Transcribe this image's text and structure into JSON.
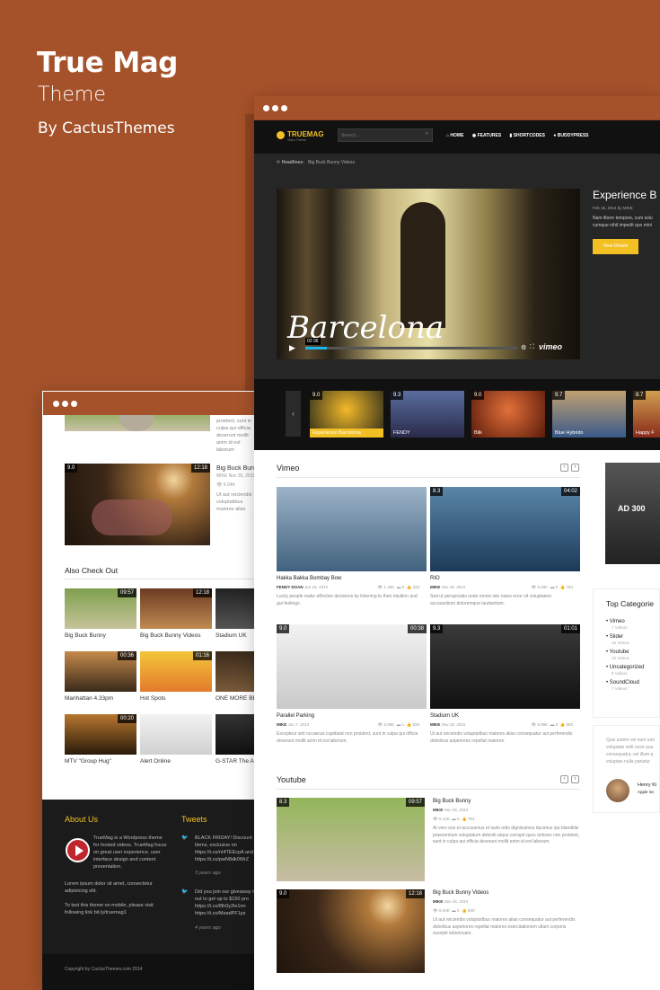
{
  "promo": {
    "title": "True Mag",
    "subtitle": "Theme",
    "byline": "By CactusThemes"
  },
  "colors": {
    "background": "#a5522a",
    "accent": "#f3c024",
    "dark": "#262626"
  },
  "back": {
    "top_items": [
      {
        "title": "Big Buck Bunny Videos",
        "score": "9.0",
        "duration": "12:18",
        "author": "MIKE",
        "date": "Nov 26, 2015",
        "views": "6.04K",
        "desc": "Ut aut reiciendis voluptatibus maiores alias consequatur aut perferendis doloribus asperiores repellat maiores exercitationem"
      }
    ],
    "top_partial": {
      "title": "Big Buck Bunny",
      "desc": "proident, sunt in culpa qui officia deserunt mollit anim id est laborum"
    },
    "also_check_out": "Also Check Out",
    "grid": [
      {
        "title": "Big Buck Bunny",
        "duration": "09:57"
      },
      {
        "title": "Big Buck Bunny Videos",
        "duration": "12:18"
      },
      {
        "title": "Stadium UK",
        "duration": ""
      },
      {
        "title": "Manhattan 4.33pm",
        "duration": "00:36"
      },
      {
        "title": "Hot Spots",
        "duration": "01:16"
      },
      {
        "title": "ONE MORE BE",
        "duration": ""
      },
      {
        "title": "MTV \"Group Hug\"",
        "duration": "00:20"
      },
      {
        "title": "Alert Online",
        "duration": ""
      },
      {
        "title": "G-STAR The A",
        "duration": ""
      }
    ],
    "about_title": "About Us",
    "about_text": "TrueMag is a Wordpress theme for hosted videos. TrueMag focus on great user experience, user interface design and content presentation.",
    "about_text2": "Lorem ipsum dolor sit amet, consectetur adipisicing elit.",
    "about_text3": "To test this theme on mobile, please visit following link bit.ly/truemag1",
    "tweets_title": "Tweets",
    "tweets": [
      {
        "text": "BLACK FRIDAY! Discount Items, exclusive on https://t.co/nI4TEEcpA and https://t.co/pwN8dk0WrZ",
        "time": "3 years ago"
      },
      {
        "text": "Did you join our giveaway it out to get up to $150 pro https://t.co/8lh0y2le1nn https://t.co/MeadPF1pz",
        "time": "4 years ago"
      }
    ],
    "copyright": "Copyright by CactusThemes.com 2014"
  },
  "front": {
    "logo": "TRUEMAG",
    "logo_tag": "Video Theme",
    "search_placeholder": "Search...",
    "nav": [
      "HOME",
      "FEATURES",
      "SHORTCODES",
      "BUDDYPRESS"
    ],
    "headlines_label": "Headlines:",
    "headline": "Big Buck Bunny Videos",
    "hero": {
      "title": "Experience B",
      "meta": "Feb 15, 2014  by MIKE",
      "text": "Nam libero tempore, cum solu cumque nihil impedit quo mini",
      "button": "View Details",
      "overlay": "Barcelona",
      "time": "02:36",
      "brand": "vimeo"
    },
    "carousel": [
      {
        "score": "9.0",
        "label": "Experience Barcelona"
      },
      {
        "score": "9.3",
        "label": "FENDY"
      },
      {
        "score": "9.0",
        "label": "Blik"
      },
      {
        "score": "9.7",
        "label": "Blue Hybrido"
      },
      {
        "score": "8.7",
        "label": "Happy F"
      }
    ],
    "vimeo_title": "Vimeo",
    "vimeo": [
      {
        "title": "Hakka Bakka Bombay Bow",
        "author": "FENDY DOAN",
        "date": "Jun 26, 2015",
        "views": "1.45K",
        "comments": "0",
        "likes": "333",
        "desc": "Lucky people make effective decisions by listening to their intuition and gut feelings.",
        "score": "",
        "duration": ""
      },
      {
        "title": "RIO",
        "author": "MIKE",
        "date": "Nov 26, 2015",
        "views": "5.93K",
        "comments": "0",
        "likes": "784",
        "desc": "Sed ut perspiciatis unde omnis iste natus error sit voluptatem accusantium doloremque laudantium.",
        "score": "8.3",
        "duration": "04:02"
      },
      {
        "title": "Parallel Parking",
        "author": "MIKE",
        "date": "Jan 7, 2014",
        "views": "5.95K",
        "comments": "1",
        "likes": "526",
        "desc": "Excepteur sint occaecat cupidatat non proident, sunt in culpa qui officia deserunt mollit anim id est laborum.",
        "score": "9.0",
        "duration": "00:38"
      },
      {
        "title": "Stadium UK",
        "author": "MIKE",
        "date": "Nov 26, 2015",
        "views": "5.95K",
        "comments": "0",
        "likes": "863",
        "desc": "Ut aut reiciendis voluptatibus maiores alias consequatur aut perferendis doloribus asperiores repellat maiores.",
        "score": "9.3",
        "duration": "01:01"
      }
    ],
    "youtube_title": "Youtube",
    "youtube": [
      {
        "title": "Big Buck Bunny",
        "author": "MIKE",
        "date": "Nov 26, 2015",
        "views": "6.12K",
        "comments": "0",
        "likes": "764",
        "desc": "At vero eos et accusamus et iusto odio dignissimos ducimus qui blanditiis praesentium voluptatum deleniti atque corrupti quos dolores non proident, sunt in culpa qui officia deserunt mollit anim id est laborum.",
        "score": "8.3",
        "duration": "09:57"
      },
      {
        "title": "Big Buck Bunny Videos",
        "author": "MIKE",
        "date": "Nov 26, 2015",
        "views": "6.04K",
        "comments": "0",
        "likes": "930",
        "desc": "Ut aut reiciendis voluptatibus maiores alias consequatur aut perferendis doloribus asperiores repellat maiores exercitationem ullam corporis suscipit laboriosam.",
        "score": "9.0",
        "duration": "12:18"
      }
    ],
    "ad": "AD 300",
    "top_categories": "Top Categorie",
    "categories": [
      {
        "name": "Vimeo",
        "count": "7 Videos"
      },
      {
        "name": "Slider",
        "count": "16 Videos"
      },
      {
        "name": "Youtube",
        "count": "10 Videos"
      },
      {
        "name": "Uncategorized",
        "count": "5 Videos"
      },
      {
        "name": "SoundCloud",
        "count": "7 Videos"
      }
    ],
    "testimonial": "Quis autem vel eum iure voluptate velit esse qua consequatur, vel illum q voluptas nulla pariatur",
    "testimonial_name": "Henry Ki",
    "testimonial_org": "Apple inc"
  }
}
